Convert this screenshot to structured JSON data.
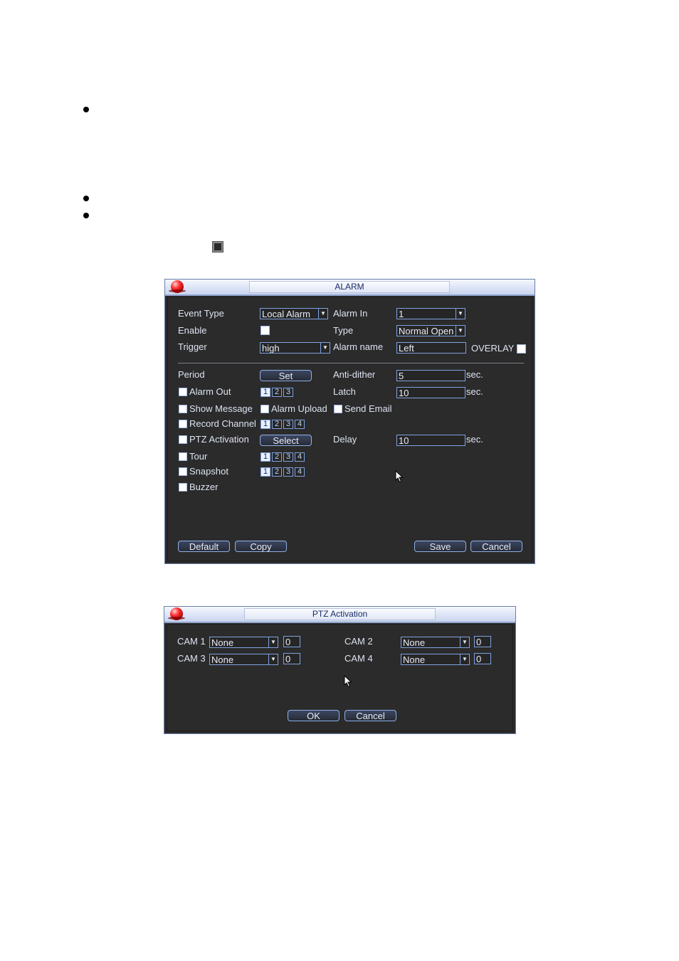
{
  "alarm_dialog": {
    "title": "ALARM",
    "event_type_label": "Event Type",
    "event_type_value": "Local Alarm",
    "alarm_in_label": "Alarm In",
    "alarm_in_value": "1",
    "enable_label": "Enable",
    "type_label": "Type",
    "type_value": "Normal Open",
    "trigger_label": "Trigger",
    "trigger_value": "high",
    "alarm_name_label": "Alarm name",
    "alarm_name_value": "Left",
    "overlay_label": "OVERLAY",
    "period_label": "Period",
    "set_button": "Set",
    "anti_dither_label": "Anti-dither",
    "anti_dither_value": "5",
    "sec_unit": "sec.",
    "alarm_out_label": "Alarm Out",
    "latch_label": "Latch",
    "latch_value": "10",
    "show_message_label": "Show Message",
    "alarm_upload_label": "Alarm Upload",
    "send_email_label": "Send Email",
    "record_channel_label": "Record Channel",
    "ptz_activation_label": "PTZ Activation",
    "select_button": "Select",
    "delay_label": "Delay",
    "delay_value": "10",
    "tour_label": "Tour",
    "snapshot_label": "Snapshot",
    "buzzer_label": "Buzzer",
    "default_button": "Default",
    "copy_button": "Copy",
    "save_button": "Save",
    "cancel_button": "Cancel",
    "alarm_out_channels": [
      "1",
      "2",
      "3"
    ],
    "record_channels": [
      "1",
      "2",
      "3",
      "4"
    ],
    "tour_channels": [
      "1",
      "2",
      "3",
      "4"
    ],
    "snapshot_channels": [
      "1",
      "2",
      "3",
      "4"
    ]
  },
  "ptz_dialog": {
    "title": "PTZ Activation",
    "cam1_label": "CAM 1",
    "cam1_value": "None",
    "cam1_num": "0",
    "cam2_label": "CAM 2",
    "cam2_value": "None",
    "cam2_num": "0",
    "cam3_label": "CAM 3",
    "cam3_value": "None",
    "cam3_num": "0",
    "cam4_label": "CAM 4",
    "cam4_value": "None",
    "cam4_num": "0",
    "ok_button": "OK",
    "cancel_button": "Cancel"
  },
  "colors": {
    "dialog_bg": "#2b2b2b",
    "field_border": "#7fa2e0",
    "title_text": "#1a2a66"
  }
}
